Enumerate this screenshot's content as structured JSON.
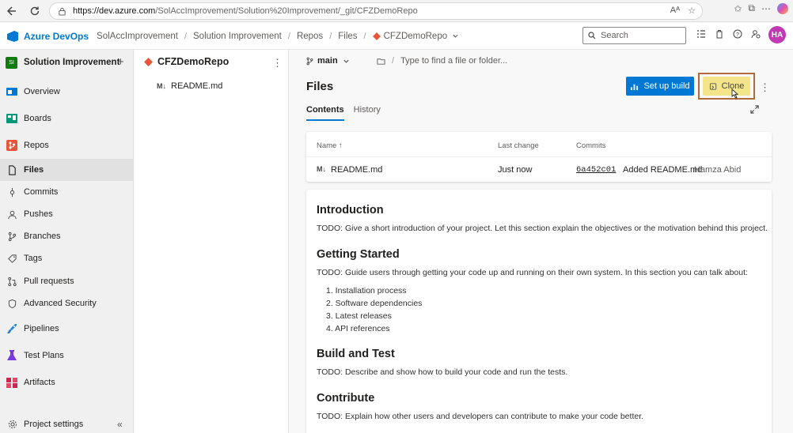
{
  "browser": {
    "url_host": "https://dev.azure.com",
    "url_path": "/SolAccImprovement/Solution%20Improvement/_git/CFZDemoRepo"
  },
  "header": {
    "brand": "Azure DevOps",
    "breadcrumbs": [
      "SolAccImprovement",
      "Solution Improvement",
      "Repos",
      "Files",
      "CFZDemoRepo"
    ],
    "search_placeholder": "Search",
    "avatar_initials": "HA"
  },
  "nav": {
    "project_initials": "SI",
    "project_name": "Solution Improvement",
    "items": [
      {
        "label": "Overview",
        "icon": "overview-icon"
      },
      {
        "label": "Boards",
        "icon": "boards-icon"
      },
      {
        "label": "Repos",
        "icon": "repos-icon"
      },
      {
        "label": "Files",
        "icon": "files-icon"
      },
      {
        "label": "Commits",
        "icon": "commits-icon"
      },
      {
        "label": "Pushes",
        "icon": "pushes-icon"
      },
      {
        "label": "Branches",
        "icon": "branches-icon"
      },
      {
        "label": "Tags",
        "icon": "tags-icon"
      },
      {
        "label": "Pull requests",
        "icon": "pull-requests-icon"
      },
      {
        "label": "Advanced Security",
        "icon": "shield-icon"
      },
      {
        "label": "Pipelines",
        "icon": "pipelines-icon"
      },
      {
        "label": "Test Plans",
        "icon": "test-plans-icon"
      },
      {
        "label": "Artifacts",
        "icon": "artifacts-icon"
      }
    ],
    "footer": "Project settings"
  },
  "tree": {
    "repo_name": "CFZDemoRepo",
    "files": [
      "README.md"
    ]
  },
  "main": {
    "branch": "main",
    "path_placeholder": "Type to find a file or folder...",
    "title": "Files",
    "setup_build_label": "Set up build",
    "clone_label": "Clone",
    "tabs": [
      "Contents",
      "History"
    ],
    "table": {
      "headers": {
        "name": "Name",
        "last_change": "Last change",
        "commits": "Commits"
      },
      "rows": [
        {
          "name": "README.md",
          "last_change": "Just now",
          "commit_hash": "6a452c01",
          "commit_message": "Added README.md",
          "commit_author": "Hamza Abid"
        }
      ]
    },
    "readme": {
      "intro_heading": "Introduction",
      "intro_text": "TODO: Give a short introduction of your project. Let this section explain the objectives or the motivation behind this project.",
      "getting_started_heading": "Getting Started",
      "getting_started_text": "TODO: Guide users through getting your code up and running on their own system. In this section you can talk about:",
      "getting_started_list": [
        "1. Installation process",
        "2. Software dependencies",
        "3. Latest releases",
        "4. API references"
      ],
      "build_heading": "Build and Test",
      "build_text": "TODO: Describe and show how to build your code and run the tests.",
      "contribute_heading": "Contribute",
      "contribute_text": "TODO: Explain how other users and developers can contribute to make your code better."
    }
  },
  "colors": {
    "accent": "#0078d4",
    "clone_highlight": "#f5e58a",
    "annotation_frame": "#b06a3b",
    "avatar": "#c239b3"
  }
}
